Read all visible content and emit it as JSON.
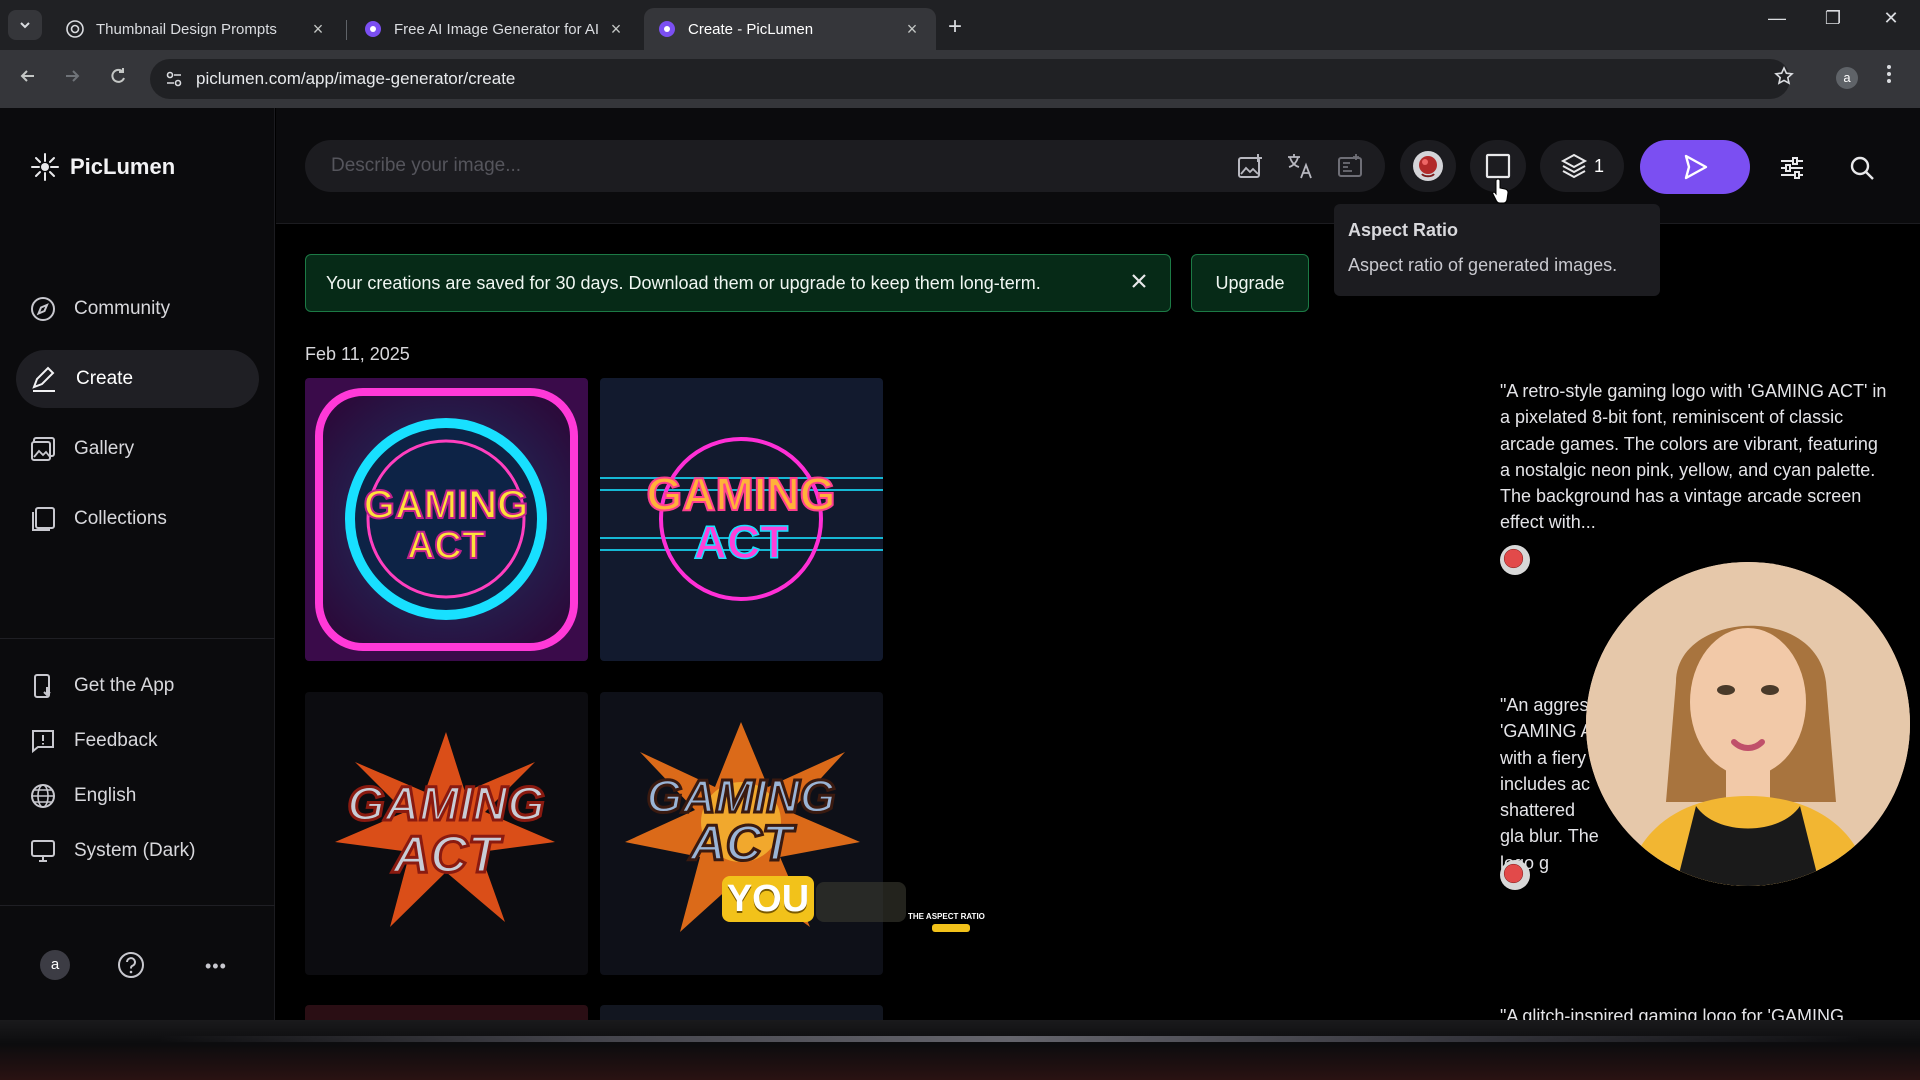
{
  "browser": {
    "tabs": [
      {
        "title": "Thumbnail Design Prompts",
        "close": "×"
      },
      {
        "title": "Free AI Image Generator for AI",
        "close": "×"
      },
      {
        "title": "Create - PicLumen",
        "close": "×"
      }
    ],
    "new_tab": "+",
    "window_controls": {
      "minimize": "—",
      "restore": "❐",
      "close": "✕"
    },
    "url": "piclumen.com/app/image-generator/create",
    "profile_initial": "a"
  },
  "app": {
    "brand": "PicLumen",
    "nav": [
      {
        "label": "Community",
        "icon": "compass-icon"
      },
      {
        "label": "Create",
        "icon": "pen-icon"
      },
      {
        "label": "Gallery",
        "icon": "image-gallery-icon"
      },
      {
        "label": "Collections",
        "icon": "bookmark-collection-icon"
      }
    ],
    "footer_nav": [
      {
        "label": "Get the App",
        "icon": "phone-app-icon"
      },
      {
        "label": "Feedback",
        "icon": "feedback-icon"
      },
      {
        "label": "English",
        "icon": "globe-icon"
      },
      {
        "label": "System (Dark)",
        "icon": "monitor-icon"
      }
    ],
    "user_initial": "a",
    "help_glyph": "?",
    "more_glyph": "•••"
  },
  "prompt": {
    "placeholder": "Describe your image...",
    "layers_count": "1"
  },
  "tooltip": {
    "title": "Aspect Ratio",
    "text": "Aspect ratio of generated images."
  },
  "banner": {
    "text": "Your creations are saved for 30 days. Download them or upgrade to keep them long-term.",
    "upgrade_label": "Upgrade"
  },
  "gallery": {
    "date": "Feb 11, 2025",
    "thumb_text": [
      "GAMING",
      "ACT"
    ],
    "overlay_caption": "YOU",
    "overlay_small": "THE ASPECT RATIO",
    "descriptions": [
      "\"A retro-style gaming logo with 'GAMING ACT' in a pixelated 8-bit font, reminiscent of classic arcade games. The colors are vibrant, featuring a nostalgic neon pink, yellow, and cyan palette. The background has a vintage arcade screen effect with...",
      "\"An aggres 'GAMING A with a fiery includes ac shattered gla blur. The logo g",
      "\"A glitch-inspired gaming logo for 'GAMING"
    ]
  },
  "colors": {
    "accent": "#7b4ff2",
    "banner_bg": "#062a17",
    "banner_border": "#1c7a45",
    "surface": "#1c1c20"
  }
}
